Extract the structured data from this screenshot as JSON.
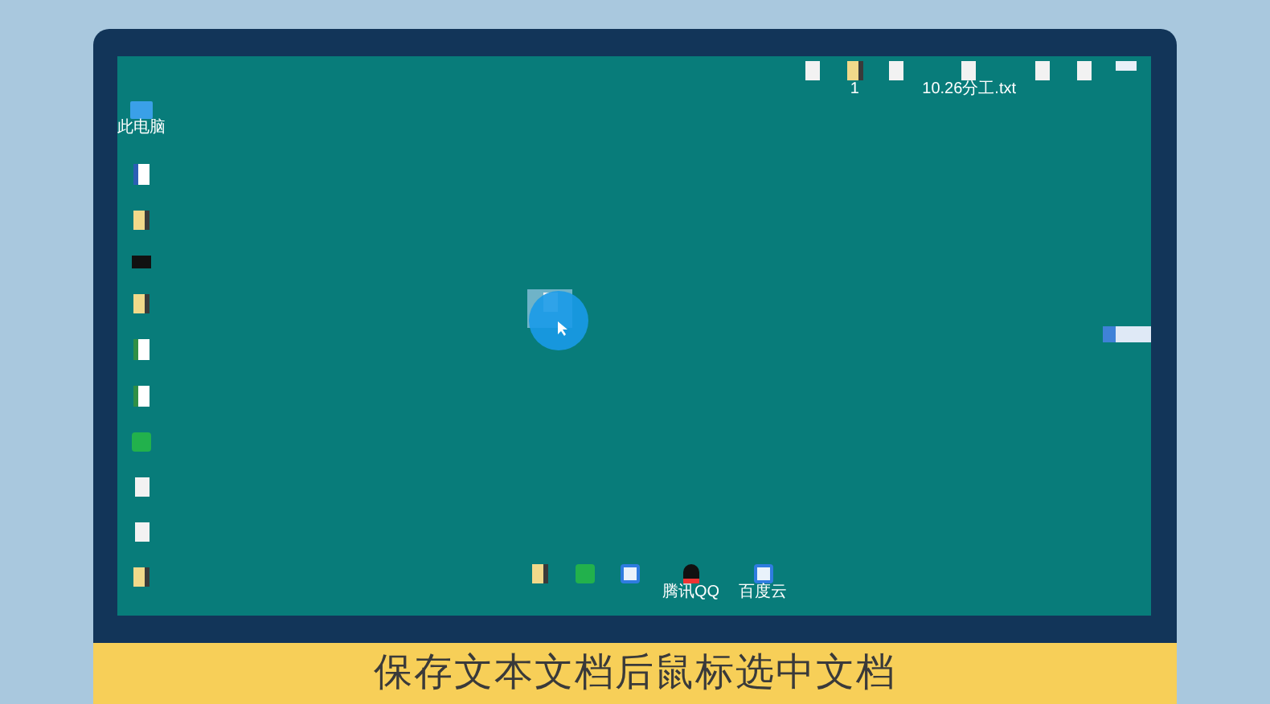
{
  "desktop": {
    "left_icons": [
      {
        "kind": "pc",
        "label": "此电脑"
      },
      {
        "kind": "doc"
      },
      {
        "kind": "folder"
      },
      {
        "kind": "video"
      },
      {
        "kind": "folder"
      },
      {
        "kind": "xls"
      },
      {
        "kind": "xls"
      },
      {
        "kind": "app"
      },
      {
        "kind": "txt"
      },
      {
        "kind": "txt"
      },
      {
        "kind": "folder"
      }
    ],
    "top_icons": [
      {
        "kind": "txt"
      },
      {
        "kind": "folder",
        "label": "1"
      },
      {
        "kind": "txt"
      },
      {
        "kind": "txt",
        "label": "10.26分工.txt"
      },
      {
        "kind": "txt"
      },
      {
        "kind": "txt"
      },
      {
        "kind": "image"
      }
    ],
    "bottom_icons": [
      {
        "kind": "folder"
      },
      {
        "kind": "app"
      },
      {
        "kind": "cloud"
      },
      {
        "kind": "qq",
        "label": "腾讯QQ"
      },
      {
        "kind": "cloud",
        "label": "百度云"
      }
    ],
    "dragged_file": {
      "kind": "txt",
      "selected": true
    }
  },
  "caption": "保存文本文档后鼠标选中文档"
}
